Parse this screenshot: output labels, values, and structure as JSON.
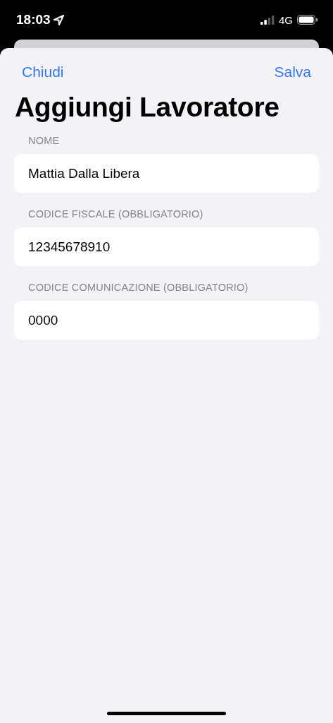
{
  "status_bar": {
    "time": "18:03",
    "network": "4G"
  },
  "nav": {
    "left": "Chiudi",
    "right": "Salva"
  },
  "title": "Aggiungi Lavoratore",
  "fields": [
    {
      "label": "NOME",
      "value": "Mattia Dalla Libera"
    },
    {
      "label": "CODICE FISCALE (OBBLIGATORIO)",
      "value": "12345678910"
    },
    {
      "label": "CODICE COMUNICAZIONE (OBBLIGATORIO)",
      "value": "0000"
    }
  ]
}
